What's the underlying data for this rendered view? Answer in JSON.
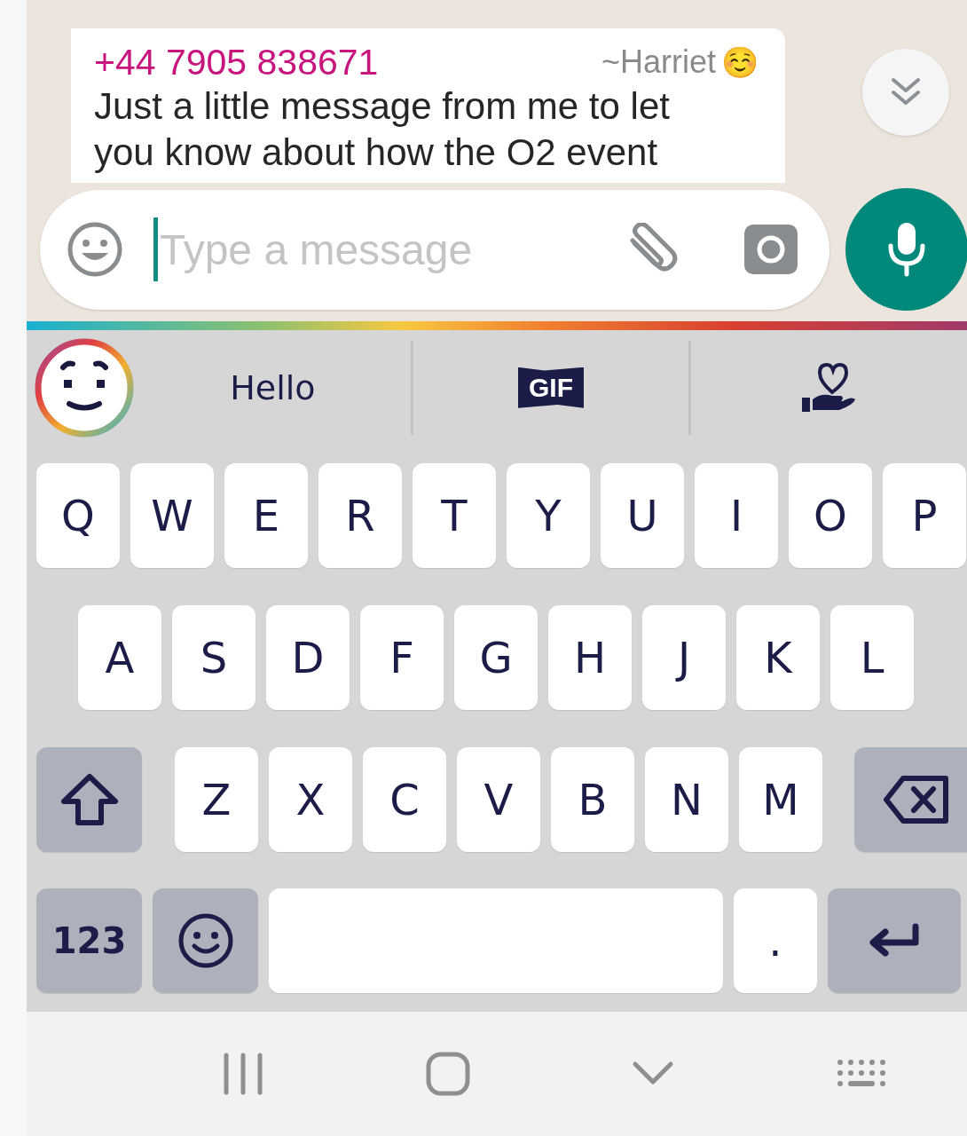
{
  "message": {
    "sender_number": "+44 7905 838671",
    "sender_name": "~Harriet",
    "sender_emoji": "☺️",
    "lines": [
      "Just a little message from me to let",
      "you know about how the O2 event"
    ]
  },
  "composer": {
    "placeholder": "Type a message"
  },
  "suggestions": [
    {
      "kind": "word",
      "label": "Hello"
    },
    {
      "kind": "gif",
      "label": "GIF"
    },
    {
      "kind": "sticker"
    }
  ],
  "keyboard": {
    "rows": [
      {
        "keys": [
          {
            "kind": "letter",
            "label": "Q"
          },
          {
            "kind": "letter",
            "label": "W"
          },
          {
            "kind": "letter",
            "label": "E"
          },
          {
            "kind": "letter",
            "label": "R"
          },
          {
            "kind": "letter",
            "label": "T"
          },
          {
            "kind": "letter",
            "label": "Y"
          },
          {
            "kind": "letter",
            "label": "U"
          },
          {
            "kind": "letter",
            "label": "I"
          },
          {
            "kind": "letter",
            "label": "O"
          },
          {
            "kind": "letter",
            "label": "P"
          }
        ]
      },
      {
        "keys": [
          {
            "kind": "letter",
            "label": "A"
          },
          {
            "kind": "letter",
            "label": "S"
          },
          {
            "kind": "letter",
            "label": "D"
          },
          {
            "kind": "letter",
            "label": "F"
          },
          {
            "kind": "letter",
            "label": "G"
          },
          {
            "kind": "letter",
            "label": "H"
          },
          {
            "kind": "letter",
            "label": "J"
          },
          {
            "kind": "letter",
            "label": "K"
          },
          {
            "kind": "letter",
            "label": "L"
          }
        ]
      },
      {
        "keys": [
          {
            "kind": "shift"
          },
          {
            "kind": "letter",
            "label": "Z"
          },
          {
            "kind": "letter",
            "label": "X"
          },
          {
            "kind": "letter",
            "label": "C"
          },
          {
            "kind": "letter",
            "label": "V"
          },
          {
            "kind": "letter",
            "label": "B"
          },
          {
            "kind": "letter",
            "label": "N"
          },
          {
            "kind": "letter",
            "label": "M"
          },
          {
            "kind": "backspace"
          }
        ]
      }
    ],
    "bottom_row": [
      {
        "kind": "symbols",
        "label": "123"
      },
      {
        "kind": "emoji"
      },
      {
        "kind": "space"
      },
      {
        "kind": "period",
        "label": "."
      },
      {
        "kind": "enter"
      }
    ]
  }
}
